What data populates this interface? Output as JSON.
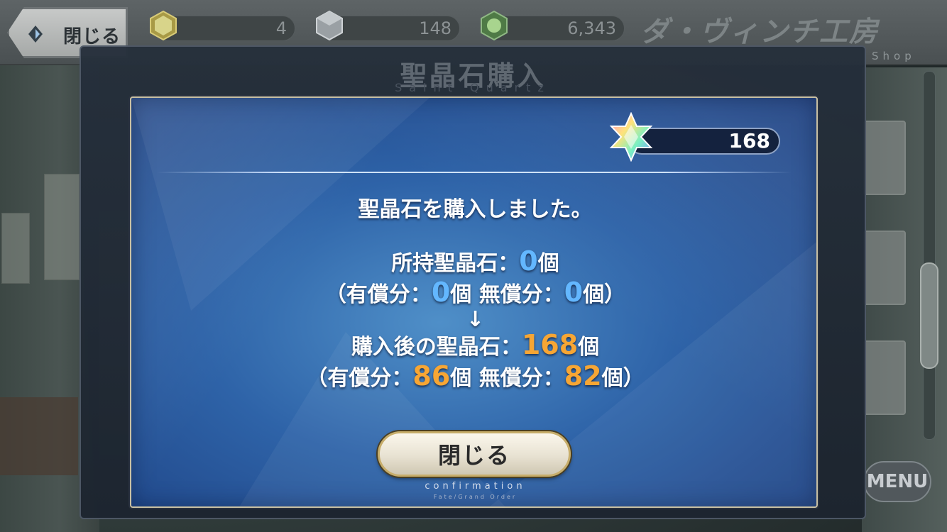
{
  "topbar": {
    "back_label": "閉じる",
    "resources": [
      {
        "icon": "gold-cube-icon",
        "value": "4",
        "color": "#c9b24a"
      },
      {
        "icon": "silver-cube-icon",
        "value": "148",
        "color": "#b8bcc0"
      },
      {
        "icon": "green-hexagon-icon",
        "value": "6,343",
        "color": "#6aa05a"
      }
    ],
    "shop_title": "ダ・ヴィンチ工房",
    "shop_sub": "Shop"
  },
  "panel": {
    "title": "聖晶石購入",
    "subtitle": "Saint Quartz"
  },
  "dialog": {
    "quartz_count": "168",
    "message": "聖晶石を購入しました。",
    "before_label": "所持聖晶石：",
    "before_total": "0",
    "before_unit": "個",
    "before_paid_label": "（有償分：",
    "before_paid": "0",
    "before_free_label": "個 無償分：",
    "before_free": "0",
    "before_close": "個）",
    "arrow": "↓",
    "after_label": "購入後の聖晶石：",
    "after_total": "168",
    "after_unit": "個",
    "after_paid_label": "（有償分：",
    "after_paid": "86",
    "after_free_label": "個 無償分：",
    "after_free": "82",
    "after_close": "個）",
    "close_button": "閉じる",
    "confirm_label": "confirmation",
    "confirm_sub": "Fate/Grand Order"
  },
  "background": {
    "menu_label": "MENU"
  }
}
